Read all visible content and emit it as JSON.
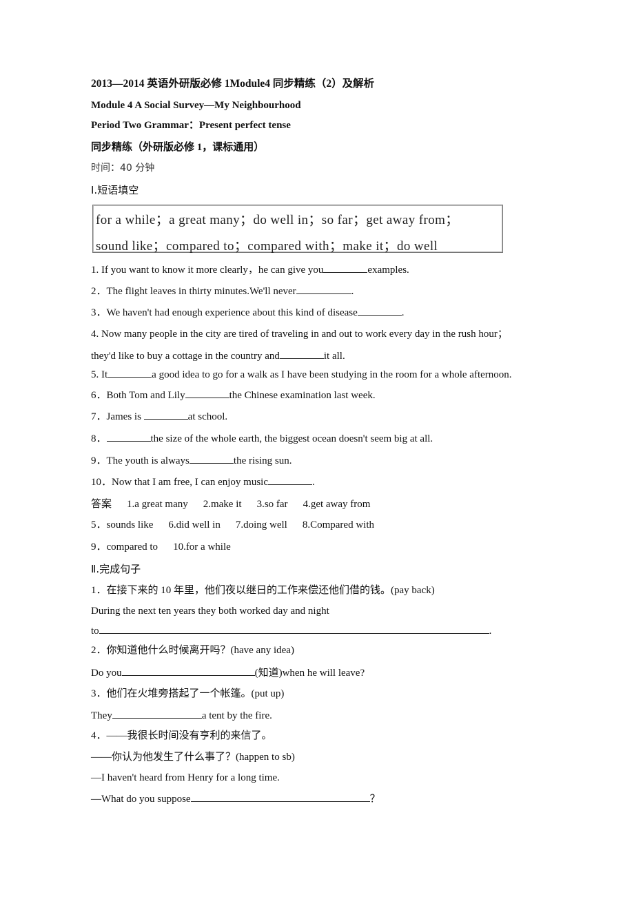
{
  "header": {
    "title": "2013—2014 英语外研版必修 1Module4 同步精练（2）及解析",
    "module": "Module 4 A Social Survey—My Neighbourhood",
    "period": "Period Two Grammar：Present perfect tense",
    "subtitle": "同步精练（外研版必修 1，课标通用）",
    "time": "时间：40 分钟"
  },
  "section1": {
    "heading": "Ⅰ.短语填空",
    "phrase_box": {
      "line1": "for a while；a great many；do well in；so far；get away from；",
      "line2": "sound like；compared to；compared with；make it；do well"
    },
    "questions": [
      {
        "pre": "1. If you want to know it more clearly，he can give you",
        "blank": 9,
        "post": "examples."
      },
      {
        "pre": "2．The flight leaves in thirty minutes.We'll never",
        "blank": 11,
        "post": "."
      },
      {
        "pre": "3．We haven't had enough experience about this kind of disease",
        "blank": 9,
        "post": "."
      },
      {
        "pre": "4. Now many people in the city are tired of traveling in and out to work every day in the rush hour；",
        "blank": 0,
        "post": ""
      },
      {
        "pre": "they'd like to buy a cottage in the country and",
        "blank": 9,
        "post": "it all."
      },
      {
        "pre": "5. It",
        "blank": 9,
        "post": "a good idea to go for a walk as I have been studying in the room for a whole afternoon."
      },
      {
        "pre": "6．Both Tom and Lily",
        "blank": 9,
        "post": "the Chinese examination last week."
      },
      {
        "pre": "7．James is ",
        "blank": 9,
        "post": "at school."
      },
      {
        "pre": "8．",
        "blank": 9,
        "post": "the size of the whole earth, the biggest ocean doesn't seem big at all."
      },
      {
        "pre": "9．The youth is always",
        "blank": 9,
        "post": "the rising sun."
      },
      {
        "pre": "10．Now that I am free, I can enjoy music",
        "blank": 9,
        "post": "."
      }
    ],
    "answers": {
      "label": "答案",
      "row1": [
        "1.a great many",
        "2.make it",
        "3.so far",
        "4.get away from"
      ],
      "row2": [
        "5．sounds like",
        "6.did well in",
        "7.doing well",
        "8.Compared with"
      ],
      "row3": [
        "9．compared to",
        "10.for a while"
      ]
    }
  },
  "section2": {
    "heading": "Ⅱ.完成句子",
    "items": [
      {
        "prompt": "1．在接下来的 10 年里，他们夜以继日的工作来偿还他们借的钱。(pay back)"
      },
      {
        "line": "During the next ten years they both worked day and night"
      },
      {
        "pre": "to",
        "post": "."
      },
      {
        "prompt": "2．你知道他什么时候离开吗？(have any idea)"
      },
      {
        "pre": "Do you",
        "post": "(知道)when he will leave?"
      },
      {
        "prompt": "3．他们在火堆旁搭起了一个帐篷。(put up)"
      },
      {
        "pre": "They",
        "post": "a tent by the fire."
      },
      {
        "prompt": "4．——我很长时间没有亨利的来信了。"
      },
      {
        "prompt": "——你认为他发生了什么事了？(happen to sb)"
      },
      {
        "line": "—I haven't heard from Henry for a long time."
      },
      {
        "pre": "—What do you suppose",
        "post": "？"
      }
    ]
  }
}
